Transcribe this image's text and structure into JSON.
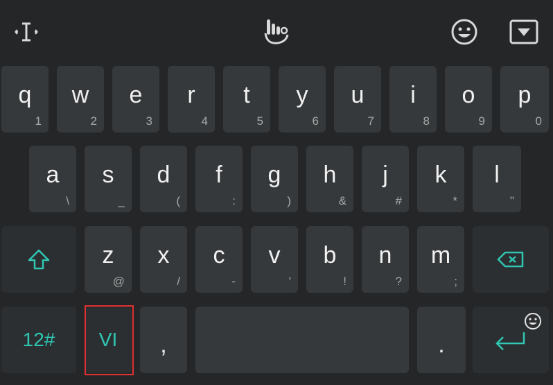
{
  "toolbar": {
    "icons": [
      "cursor-icon",
      "touchpal-hand-icon",
      "emoji-icon",
      "hide-keyboard-icon"
    ]
  },
  "rows": {
    "row1": [
      {
        "main": "q",
        "sub": "1"
      },
      {
        "main": "w",
        "sub": "2"
      },
      {
        "main": "e",
        "sub": "3"
      },
      {
        "main": "r",
        "sub": "4"
      },
      {
        "main": "t",
        "sub": "5"
      },
      {
        "main": "y",
        "sub": "6"
      },
      {
        "main": "u",
        "sub": "7"
      },
      {
        "main": "i",
        "sub": "8"
      },
      {
        "main": "o",
        "sub": "9"
      },
      {
        "main": "p",
        "sub": "0"
      }
    ],
    "row2": [
      {
        "main": "a",
        "sub": "\\"
      },
      {
        "main": "s",
        "sub": "_"
      },
      {
        "main": "d",
        "sub": "("
      },
      {
        "main": "f",
        "sub": ":"
      },
      {
        "main": "g",
        "sub": ")"
      },
      {
        "main": "h",
        "sub": "&"
      },
      {
        "main": "j",
        "sub": "#"
      },
      {
        "main": "k",
        "sub": "*"
      },
      {
        "main": "l",
        "sub": "\""
      }
    ],
    "row3": [
      {
        "main": "z",
        "sub": "@"
      },
      {
        "main": "x",
        "sub": "/"
      },
      {
        "main": "c",
        "sub": "-"
      },
      {
        "main": "v",
        "sub": "'"
      },
      {
        "main": "b",
        "sub": "!"
      },
      {
        "main": "n",
        "sub": "?"
      },
      {
        "main": "m",
        "sub": ";"
      }
    ]
  },
  "bottom": {
    "symbols_label": "12#",
    "language_label": "VI",
    "comma_label": ",",
    "period_label": "."
  },
  "colors": {
    "background": "#242628",
    "key": "#36393b",
    "function_key": "#2c2f31",
    "accent": "#2fc7b4",
    "highlight_box": "#e03030"
  }
}
